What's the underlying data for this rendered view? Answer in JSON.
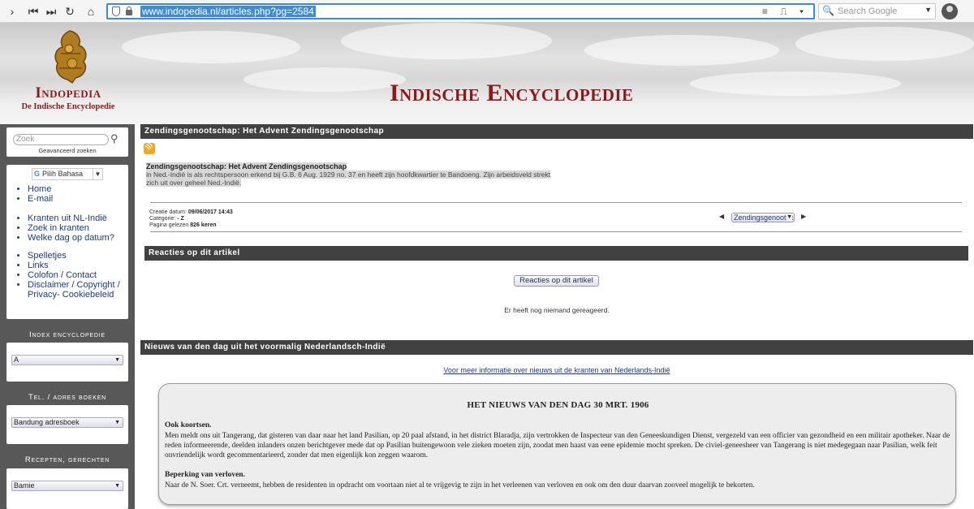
{
  "browser": {
    "url": "www.indopedia.nl/articles.php?pg=2584",
    "search_placeholder": "Search Google"
  },
  "banner": {
    "logo_title": "Indopedia",
    "logo_subtitle": "De Indische Encyclopedie",
    "site_title": "Indische Encyclopedie"
  },
  "sidebar": {
    "search_placeholder": "Zoek",
    "advanced_search": "Geavanceerd zoeken",
    "translate_label": "Pilih Bahasa",
    "nav_group1": [
      "Home",
      "E-mail"
    ],
    "nav_group2": [
      "Kranten uit NL-Indië",
      "Zoek in kranten",
      "Welke dag op datum?"
    ],
    "nav_group3": [
      "Spelletjes",
      "Links",
      "Colofon / Contact",
      "Disclaimer / Copyright / Privacy- Cookiebeleid"
    ],
    "index_heading": "Index encyclopedie",
    "index_value": "A",
    "phone_heading": "Tel. / adres boeken",
    "phone_value": "Bandung adresboek",
    "recipes_heading": "Recepten, gerechten",
    "recipes_value": "Bamie"
  },
  "article": {
    "header": "Zendingsgenootschap: Het Advent Zendingsgenootschap",
    "title": "Zendingsgenootschap: Het Advent Zendingsgenootschap",
    "body_line1": "in Ned.-Indië is als rechtspersoon erkend bij G.B. 6 Aug. 1929 no. 37 en heeft zijn hoofdkwartier te Bandoeng. Zijn arbeidsveld strekt",
    "body_line2": "zich uit over geheel Ned.-Indië.",
    "created_label": "Creatie datum:",
    "created_value": "09/06/2017 14:43",
    "category_label": "Categorie:",
    "category_value": "- Z",
    "views_label": "Pagina gelezen",
    "views_value": "826 keren",
    "pager_value": "Zendingsgenootschap"
  },
  "reactions": {
    "header": "Reacties op dit artikel",
    "button": "Reacties op dit artikel",
    "empty": "Er heeft nog niemand gereageerd."
  },
  "news": {
    "header": "Nieuws van den dag uit het voormalig Nederlandsch-Indië",
    "more_link": "Voor meer informatie over nieuws uit de kranten van Nederlands-Indië",
    "box_title": "HET NIEUWS VAN DEN DAG 30 MRT. 1906",
    "item1_title": "Ook koortsen.",
    "item1_body": "Men meldt ons uit Tangerang, dat gisteren van daar naar het land Pasilian, op 20 paal afstand, in het district Blaradja, zijn vertrokken de Inspecteur van den Geneeskundigen Dienst, vergezeld van een officier van gezondheid en een militair apotheker. Naar de reden informeerende, deelden inlanders onzen berichtgever mede dat op Pasilian buitengewoon vele zieken moeten zijn, zoodat men haast van eene epidemie mocht spreken. De civiel-geneesheer van Tangerang is niet medegegaan naar Pasilian, welk feit onvriendelijk wordt gecommentarieerd, zonder dat men eigenlijk kon zeggen waarom.",
    "item2_title": "Beperking van verloven.",
    "item2_body": "Naar de N. Soer. Crt. verneemt, hebben de residenten in opdracht om voortaan niet al te vrijgevig te zijn in het verleenen van verloven en ook om den duur daarvan zooveel mogelijk te bekorten."
  }
}
